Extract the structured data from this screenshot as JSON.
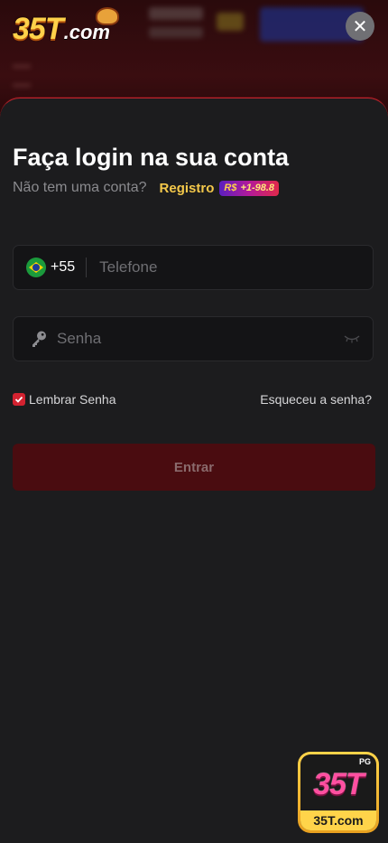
{
  "header": {
    "logo_big": "35T",
    "logo_small": ".com",
    "close_symbol": "✕"
  },
  "login": {
    "title": "Faça login na sua conta",
    "no_account_text": "Não tem uma conta?",
    "register_label": "Registro",
    "bonus_badge": {
      "currency": "R$",
      "value": "+1-98.8"
    },
    "phone": {
      "country_code": "+55",
      "placeholder": "Telefone",
      "value": ""
    },
    "password": {
      "placeholder": "Senha",
      "value": ""
    },
    "remember_label": "Lembrar Senha",
    "remember_checked": true,
    "forgot_label": "Esqueceu a senha?",
    "submit_label": "Entrar"
  },
  "app_badge": {
    "tag": "PG",
    "big": "35T",
    "domain": "35T.com"
  },
  "icons": [
    "close-icon",
    "brazil-flag-icon",
    "key-icon",
    "eye-closed-icon",
    "checkbox-checked-icon"
  ],
  "colors": {
    "accent_red": "#d32230",
    "register_yellow": "#f4c84a",
    "submit_bg": "#4a0c10"
  }
}
